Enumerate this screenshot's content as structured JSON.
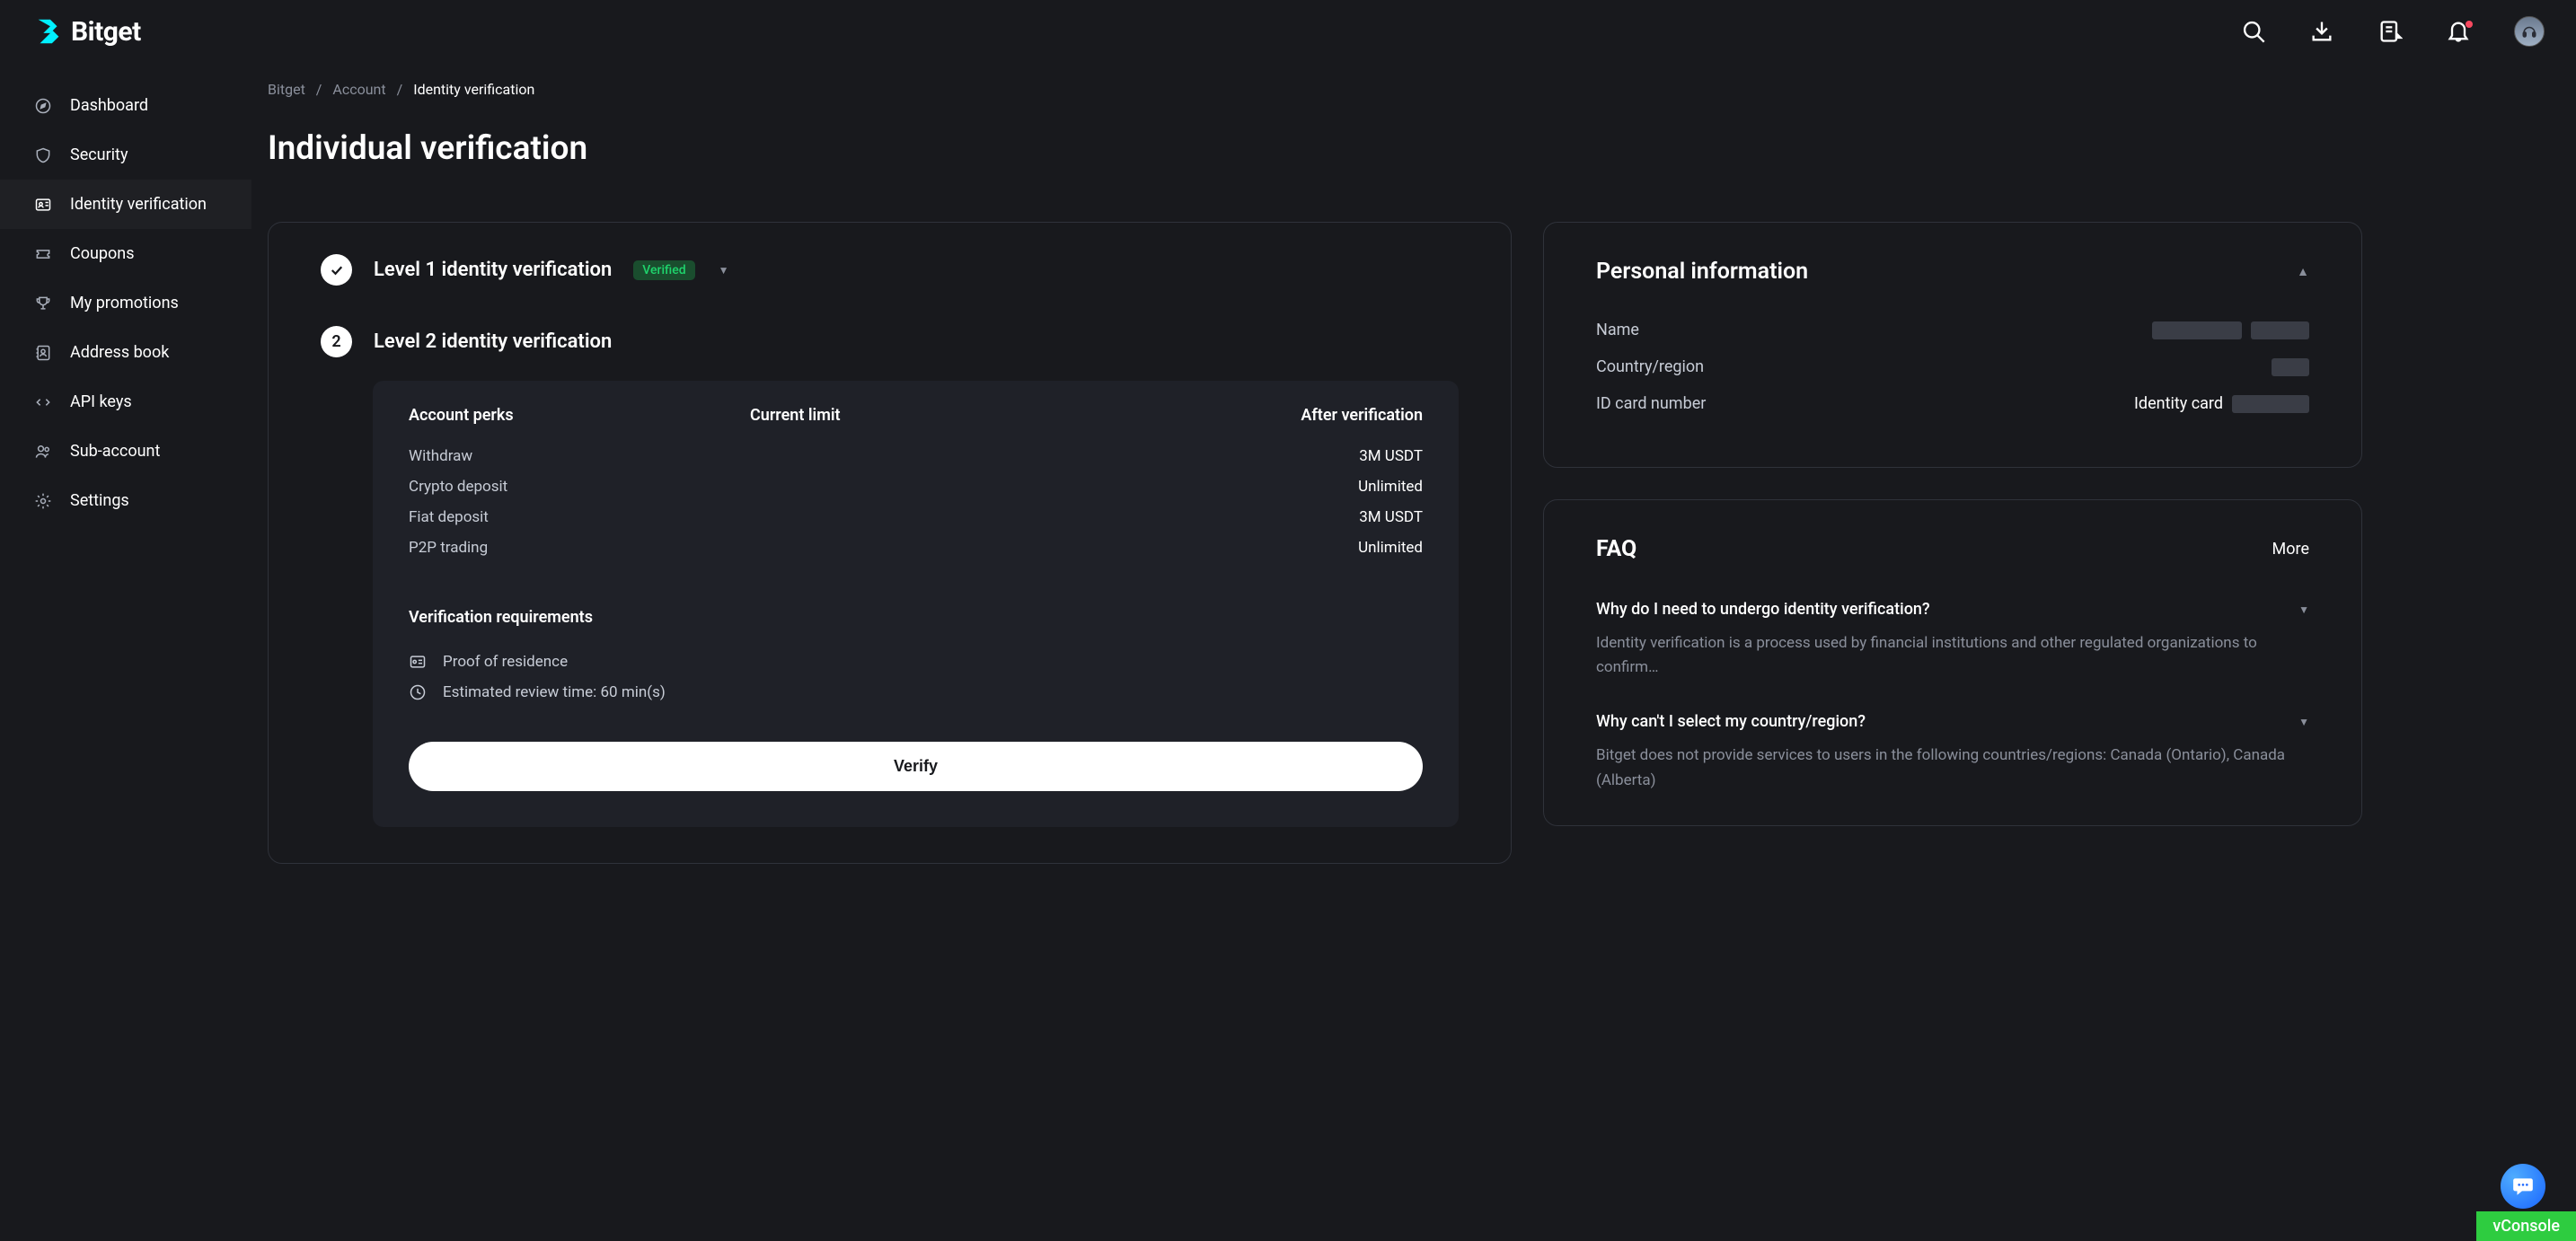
{
  "header": {
    "brand": "Bitget"
  },
  "sidebar": {
    "items": [
      {
        "label": "Dashboard"
      },
      {
        "label": "Security"
      },
      {
        "label": "Identity verification"
      },
      {
        "label": "Coupons"
      },
      {
        "label": "My promotions"
      },
      {
        "label": "Address book"
      },
      {
        "label": "API keys"
      },
      {
        "label": "Sub-account"
      },
      {
        "label": "Settings"
      }
    ]
  },
  "breadcrumb": {
    "root": "Bitget",
    "mid": "Account",
    "current": "Identity verification"
  },
  "page_title": "Individual verification",
  "level1": {
    "title": "Level 1 identity verification",
    "badge": "Verified"
  },
  "level2": {
    "step": "2",
    "title": "Level 2 identity verification",
    "headers": {
      "c1": "Account perks",
      "c2": "Current limit",
      "c3": "After verification"
    },
    "rows": [
      {
        "perk": "Withdraw",
        "current": "",
        "after": "3M USDT"
      },
      {
        "perk": "Crypto deposit",
        "current": "",
        "after": "Unlimited"
      },
      {
        "perk": "Fiat deposit",
        "current": "",
        "after": "3M USDT"
      },
      {
        "perk": "P2P trading",
        "current": "",
        "after": "Unlimited"
      }
    ],
    "req_title": "Verification requirements",
    "req_items": [
      "Proof of residence",
      "Estimated review time: 60 min(s)"
    ],
    "verify_label": "Verify"
  },
  "personal": {
    "title": "Personal information",
    "rows": {
      "name_label": "Name",
      "country_label": "Country/region",
      "id_label": "ID card number",
      "id_type": "Identity card"
    }
  },
  "faq": {
    "title": "FAQ",
    "more": "More",
    "items": [
      {
        "q": "Why do I need to undergo identity verification?",
        "a": "Identity verification is a process used by financial institutions and other regulated organizations to confirm…"
      },
      {
        "q": "Why can't I select my country/region?",
        "a": "Bitget does not provide services to users in the following countries/regions: Canada (Ontario), Canada (Alberta)"
      }
    ]
  },
  "vconsole": "vConsole"
}
